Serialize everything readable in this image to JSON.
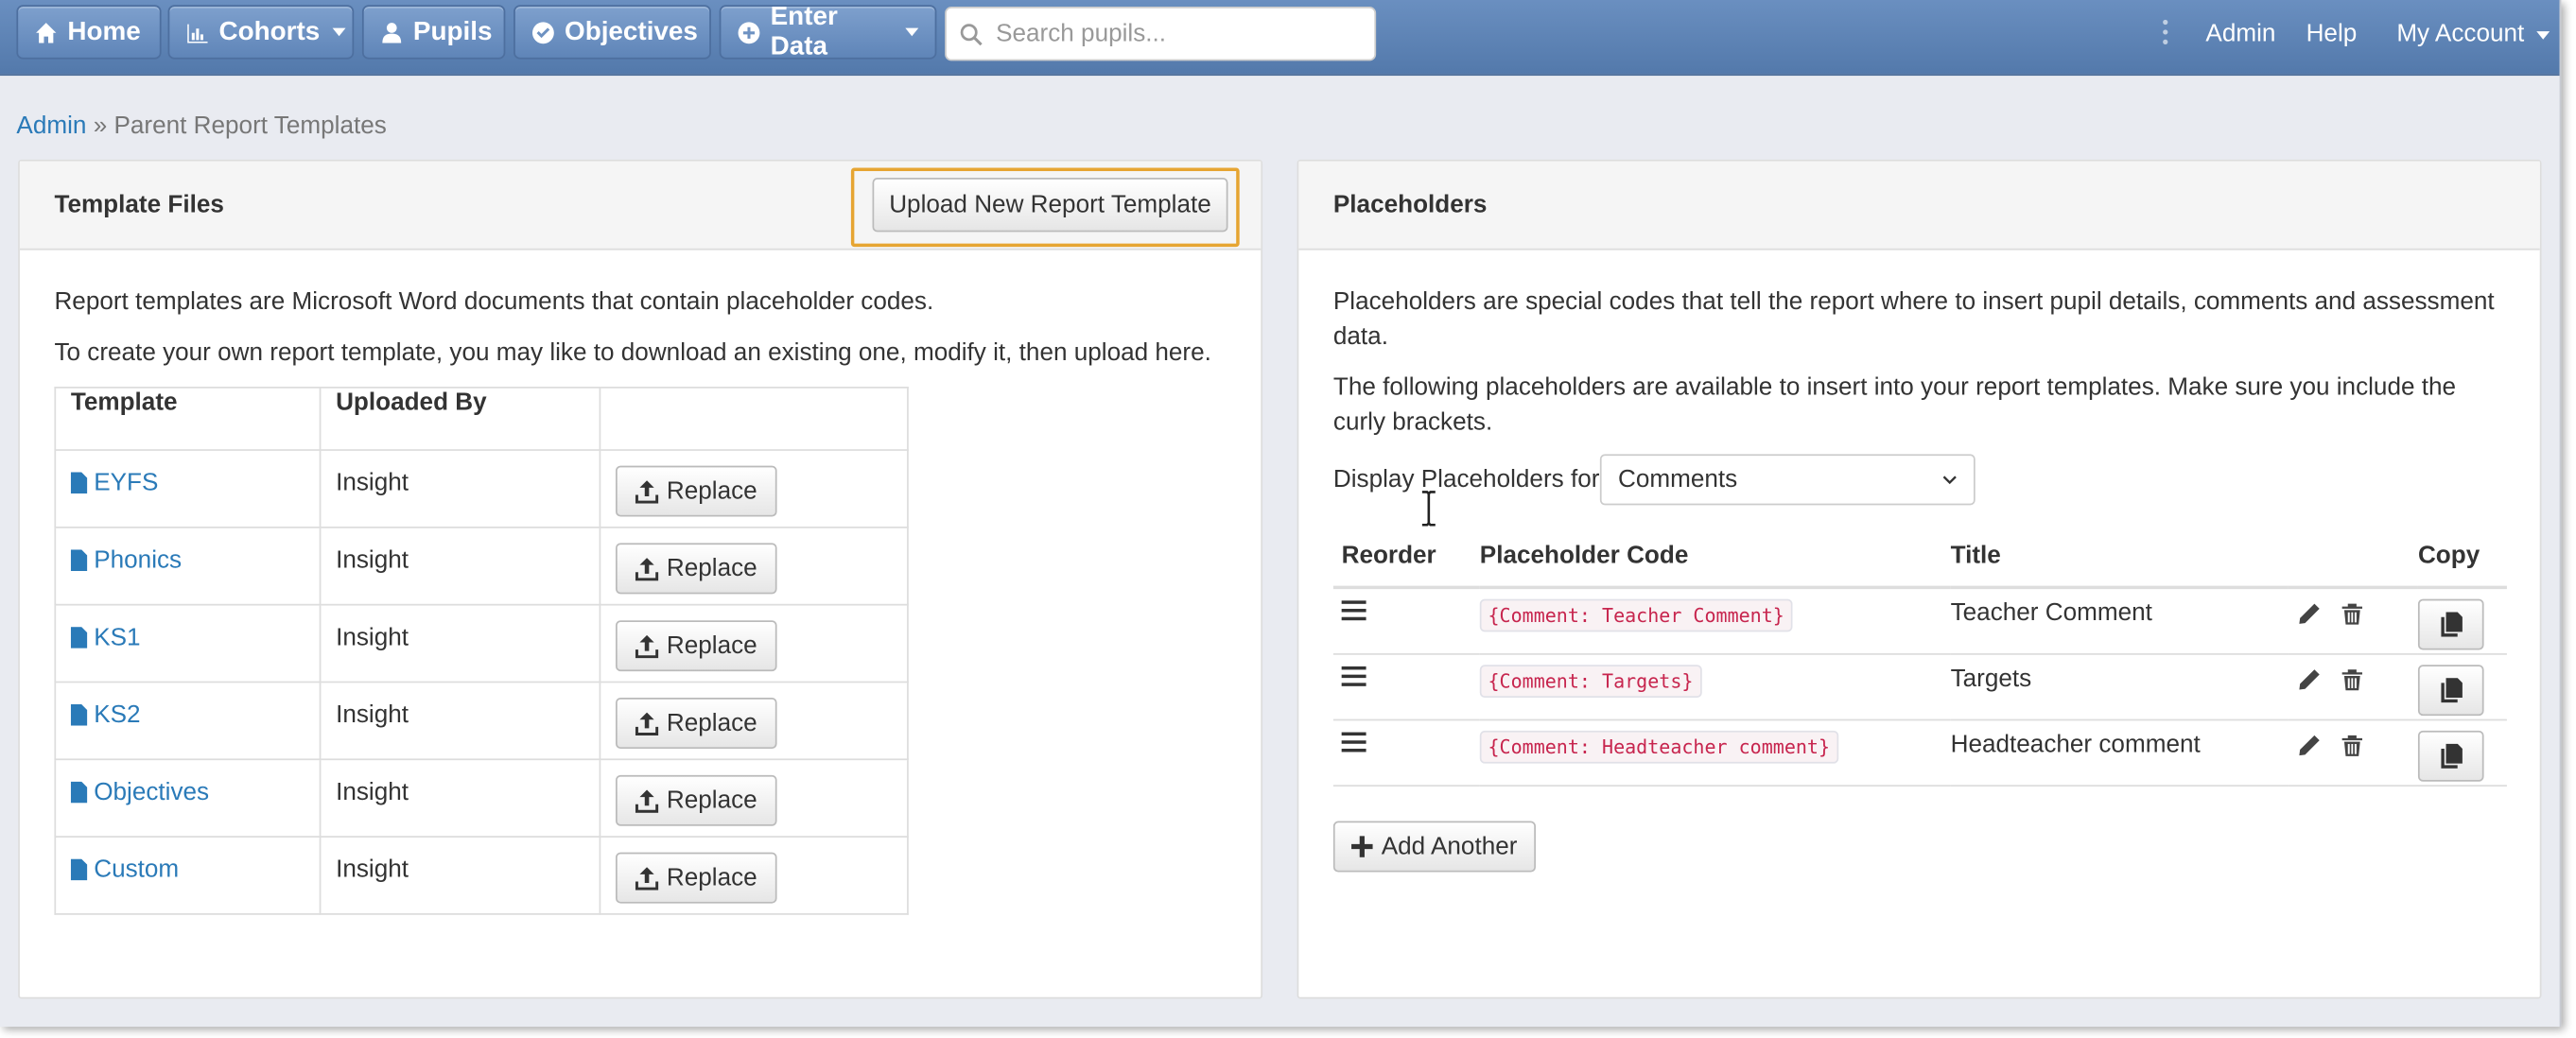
{
  "navbar": {
    "home": "Home",
    "cohorts": "Cohorts",
    "pupils": "Pupils",
    "objectives": "Objectives",
    "enter_data": "Enter Data",
    "search_placeholder": "Search pupils...",
    "admin": "Admin",
    "help": "Help",
    "my_account": "My Account"
  },
  "breadcrumb": {
    "root": "Admin",
    "separator": "»",
    "current": "Parent Report Templates"
  },
  "template_files": {
    "title": "Template Files",
    "upload_button": "Upload New Report Template",
    "intro_1": "Report templates are Microsoft Word documents that contain placeholder codes.",
    "intro_2": "To create your own report template, you may like to download an existing one, modify it, then upload here.",
    "columns": [
      "Template",
      "Uploaded By",
      ""
    ],
    "rows": [
      {
        "name": "EYFS",
        "uploaded_by": "Insight",
        "action": "Replace"
      },
      {
        "name": "Phonics",
        "uploaded_by": "Insight",
        "action": "Replace"
      },
      {
        "name": "KS1",
        "uploaded_by": "Insight",
        "action": "Replace"
      },
      {
        "name": "KS2",
        "uploaded_by": "Insight",
        "action": "Replace"
      },
      {
        "name": "Objectives",
        "uploaded_by": "Insight",
        "action": "Replace"
      },
      {
        "name": "Custom",
        "uploaded_by": "Insight",
        "action": "Replace"
      }
    ]
  },
  "placeholders": {
    "title": "Placeholders",
    "intro_1": "Placeholders are special codes that tell the report where to insert pupil details, comments and assessment data.",
    "intro_2": "The following placeholders are available to insert into your report templates. Make sure you include the curly brackets.",
    "display_label": "Display Placeholders for",
    "display_value": "Comments",
    "columns": [
      "Reorder",
      "Placeholder Code",
      "Title",
      "",
      "Copy"
    ],
    "rows": [
      {
        "code": "{Comment: Teacher Comment}",
        "title": "Teacher Comment"
      },
      {
        "code": "{Comment: Targets}",
        "title": "Targets"
      },
      {
        "code": "{Comment: Headteacher comment}",
        "title": "Headteacher comment"
      }
    ],
    "add_button": "Add Another"
  },
  "colors": {
    "navbar": "#5f85b8",
    "link": "#2a7ab8",
    "highlight": "#e6a532",
    "code_text": "#c7254e"
  }
}
